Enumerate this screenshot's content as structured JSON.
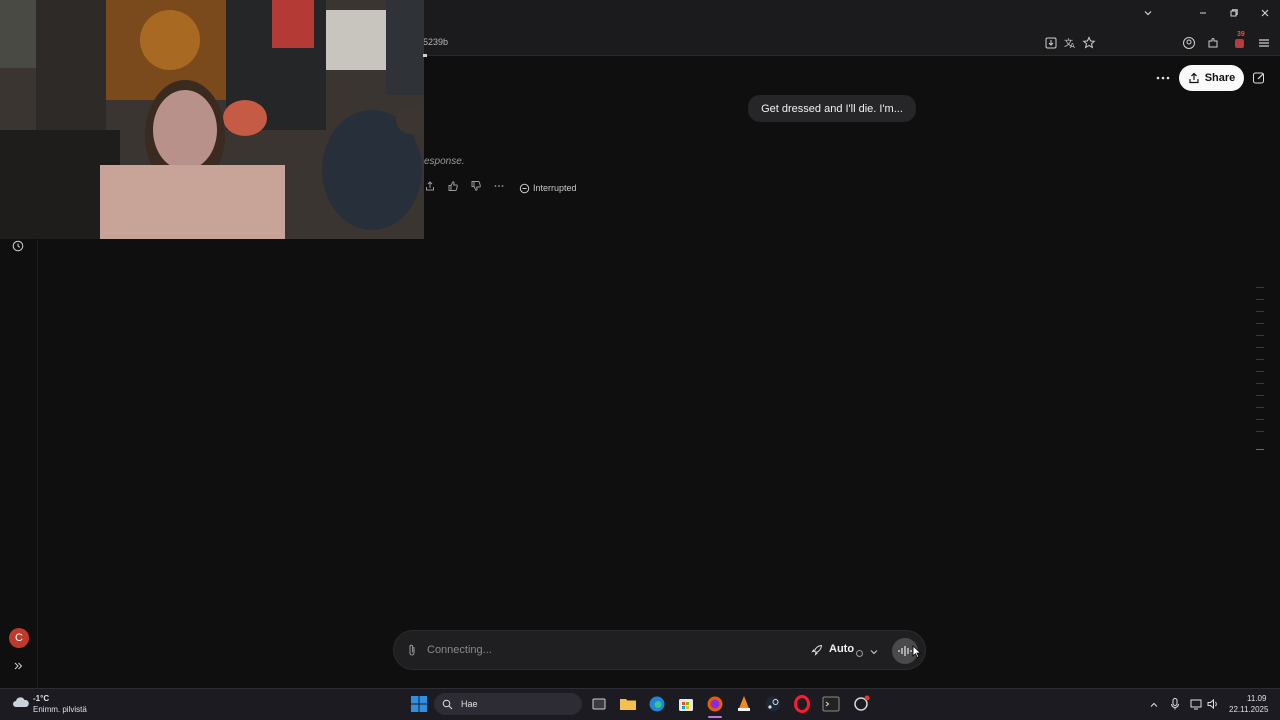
{
  "browser": {
    "url_fragment": "5239b"
  },
  "header": {
    "share_label": "Share"
  },
  "conversation": {
    "user_message": "Get dressed and I'll die. I'm...",
    "assistant_partial": "esponse.",
    "status_label": "Interrupted"
  },
  "composer": {
    "placeholder": "Connecting...",
    "model_label": "Auto"
  },
  "sidebar": {
    "avatar_letter": "C"
  },
  "taskbar": {
    "weather_temp": "-1°C",
    "weather_desc": "Enimm. pilvistä",
    "search_label": "Hae",
    "time": "11.09",
    "date": "22.11.2025",
    "notification_count": "39"
  },
  "colors": {
    "app_bg": "#0f0f10",
    "share_bg": "#fafafa",
    "bubble_bg": "#262628",
    "avatar_red": "#c0392b",
    "taskbar_bg": "#1c1b22"
  }
}
